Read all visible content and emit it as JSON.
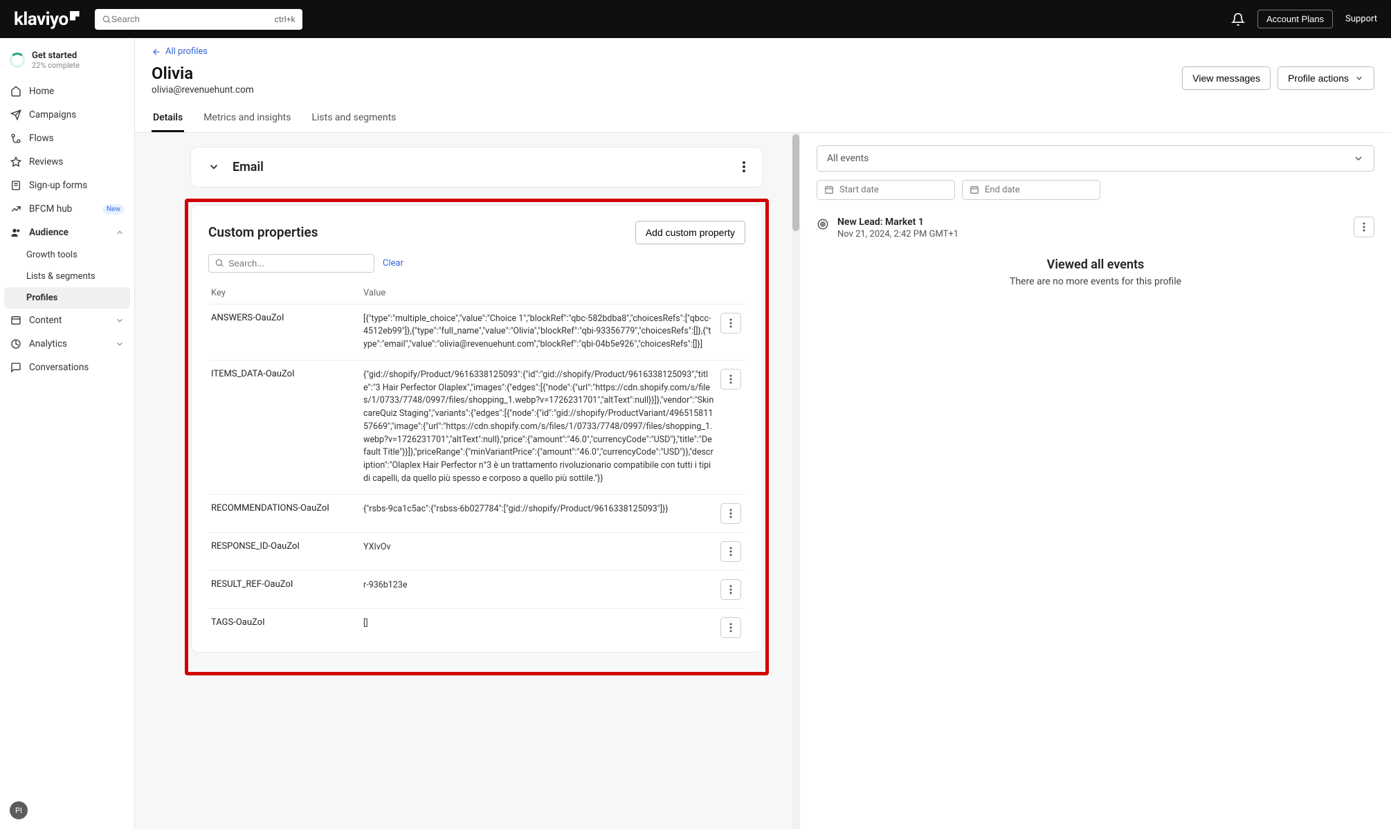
{
  "topbar": {
    "brand": "klaviyo",
    "search_placeholder": "Search",
    "shortcut": "ctrl+k",
    "account_plans": "Account Plans",
    "support": "Support"
  },
  "sidebar": {
    "getstarted_title": "Get started",
    "getstarted_sub": "22% complete",
    "items": {
      "home": "Home",
      "campaigns": "Campaigns",
      "flows": "Flows",
      "reviews": "Reviews",
      "signup": "Sign-up forms",
      "bfcm": "BFCM hub",
      "bfcm_badge": "New",
      "audience": "Audience",
      "growth": "Growth tools",
      "lists": "Lists & segments",
      "profiles": "Profiles",
      "content": "Content",
      "analytics": "Analytics",
      "conversations": "Conversations"
    },
    "avatar": "PI"
  },
  "header": {
    "back": "All profiles",
    "name": "Olivia",
    "email": "olivia@revenuehunt.com",
    "view_messages": "View messages",
    "profile_actions": "Profile actions",
    "tabs": {
      "details": "Details",
      "metrics": "Metrics and insights",
      "lists": "Lists and segments"
    }
  },
  "email_card": {
    "title": "Email"
  },
  "custom": {
    "title": "Custom properties",
    "add_btn": "Add custom property",
    "search_placeholder": "Search...",
    "clear": "Clear",
    "col_key": "Key",
    "col_value": "Value",
    "rows": [
      {
        "key": "ANSWERS-OauZoI",
        "value": "[{\"type\":\"multiple_choice\",\"value\":\"Choice 1\",\"blockRef\":\"qbc-582bdba8\",\"choicesRefs\":[\"qbcc-4512eb99\"]},{\"type\":\"full_name\",\"value\":\"Olivia\",\"blockRef\":\"qbi-93356779\",\"choicesRefs\":[]},{\"type\":\"email\",\"value\":\"olivia@revenuehunt.com\",\"blockRef\":\"qbi-04b5e926\",\"choicesRefs\":[]}]"
      },
      {
        "key": "ITEMS_DATA-OauZoI",
        "value": "{\"gid://shopify/Product/9616338125093\":{\"id\":\"gid://shopify/Product/9616338125093\",\"title\":\"3 Hair Perfector Olaplex\",\"images\":{\"edges\":[{\"node\":{\"url\":\"https://cdn.shopify.com/s/files/1/0733/7748/0997/files/shopping_1.webp?v=1726231701\",\"altText\":null}}]},\"vendor\":\"SkincareQuiz Staging\",\"variants\":{\"edges\":[{\"node\":{\"id\":\"gid://shopify/ProductVariant/49651581157669\",\"image\":{\"url\":\"https://cdn.shopify.com/s/files/1/0733/7748/0997/files/shopping_1.webp?v=1726231701\",\"altText\":null},\"price\":{\"amount\":\"46.0\",\"currencyCode\":\"USD\"},\"title\":\"Default Title\"}}]},\"priceRange\":{\"minVariantPrice\":{\"amount\":\"46.0\",\"currencyCode\":\"USD\"}},\"description\":\"Olaplex Hair Perfector n°3 è un trattamento rivoluzionario compatibile con tutti i tipi di capelli, da quello più spesso e corposo a quello più sottile.\"}}"
      },
      {
        "key": "RECOMMENDATIONS-OauZoI",
        "value": "{\"rsbs-9ca1c5ac\":{\"rsbss-6b027784\":[\"gid://shopify/Product/9616338125093\"]}}"
      },
      {
        "key": "RESPONSE_ID-OauZoI",
        "value": "YXIvOv"
      },
      {
        "key": "RESULT_REF-OauZoI",
        "value": "r-936b123e"
      },
      {
        "key": "TAGS-OauZoI",
        "value": "[]"
      }
    ]
  },
  "events": {
    "filter_all": "All events",
    "start_date": "Start date",
    "end_date": "End date",
    "items": [
      {
        "title": "New Lead: Market 1",
        "date": "Nov 21, 2024, 2:42 PM GMT+1"
      }
    ],
    "footer_title": "Viewed all events",
    "footer_sub": "There are no more events for this profile"
  }
}
